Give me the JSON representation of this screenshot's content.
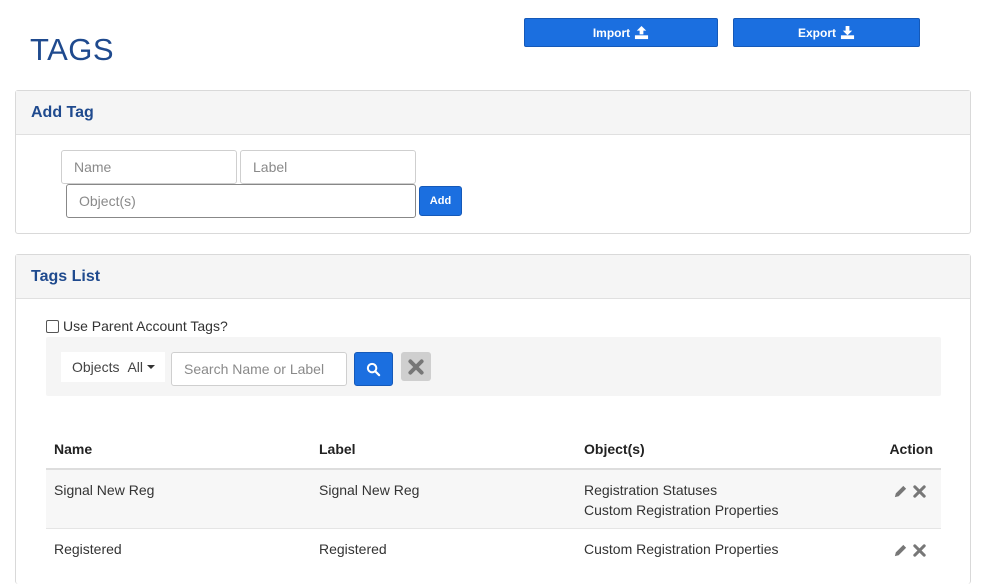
{
  "page": {
    "title": "TAGS",
    "import_label": "Import",
    "export_label": "Export"
  },
  "add_tag": {
    "header": "Add Tag",
    "name_placeholder": "Name",
    "label_placeholder": "Label",
    "objects_placeholder": "Object(s)",
    "add_label": "Add"
  },
  "tags_list": {
    "header": "Tags List",
    "use_parent_label": "Use Parent Account Tags?",
    "objects_label": "Objects",
    "objects_value": "All",
    "search_placeholder": "Search Name or Label",
    "columns": [
      "Name",
      "Label",
      "Object(s)",
      "Action"
    ],
    "rows": [
      {
        "name": "Signal New Reg",
        "label": "Signal New Reg",
        "objects": [
          "Registration Statuses",
          "Custom Registration Properties"
        ]
      },
      {
        "name": "Registered",
        "label": "Registered",
        "objects": [
          "Custom Registration Properties"
        ]
      }
    ]
  },
  "colors": {
    "primary": "#1b6fe0",
    "title": "#1f4a8e",
    "panel_header_bg": "#f5f5f5"
  },
  "icons": {
    "import": "upload-icon",
    "export": "download-icon",
    "search": "search-icon",
    "clear": "close-icon",
    "edit": "pencil-icon",
    "delete": "close-icon"
  }
}
